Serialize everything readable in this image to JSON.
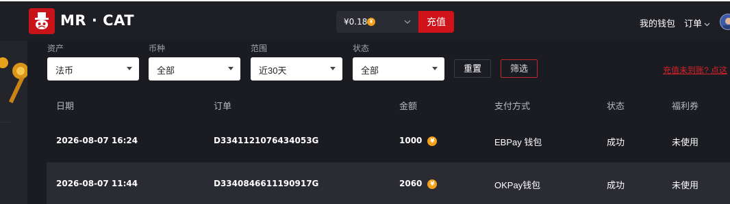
{
  "header": {
    "brand": "MR · CAT",
    "balance": "¥0.18",
    "recharge_label": "充值",
    "wallet_label": "我的钱包",
    "orders_label": "订单"
  },
  "filters": {
    "asset": {
      "label": "资产",
      "value": "法币"
    },
    "currency": {
      "label": "币种",
      "value": "全部"
    },
    "range": {
      "label": "范围",
      "value": "近30天"
    },
    "status": {
      "label": "状态",
      "value": "全部"
    },
    "reset_label": "重置",
    "filter_label": "筛选",
    "notice_link": "充值未到账? 点这"
  },
  "table": {
    "columns": [
      "日期",
      "订单",
      "金额",
      "支付方式",
      "状态",
      "福利券"
    ],
    "rows": [
      {
        "date": "2026-08-07 16:24",
        "order": "D3341121076434053G",
        "amount": "1000",
        "method": "EBPay 钱包",
        "status": "成功",
        "coupon": "未使用"
      },
      {
        "date": "2026-08-07 11:44",
        "order": "D3340846611190917G",
        "amount": "2060",
        "method": "OKPay钱包",
        "status": "成功",
        "coupon": "未使用"
      }
    ]
  },
  "icons": {
    "logo": "cat-hat-logo-icon",
    "coin": "yuan-coin-icon",
    "dropdown": "chevron-down-icon"
  },
  "colors": {
    "accent": "#d0121b",
    "coin": "#f3a11a",
    "background": "#1b1c22",
    "row_alt": "#2a2b33"
  }
}
